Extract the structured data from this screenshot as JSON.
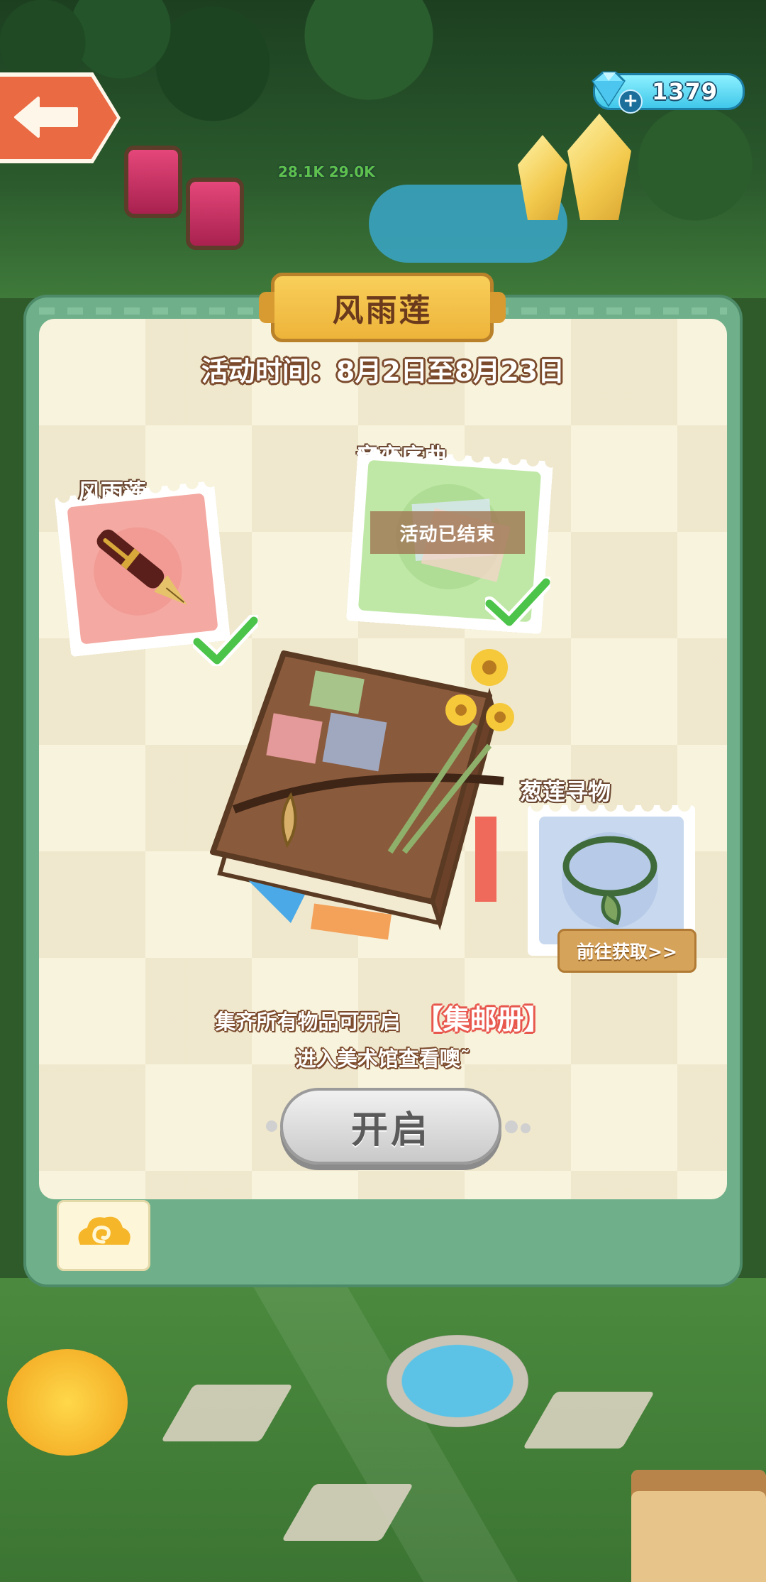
{
  "hud": {
    "gem_count": "1379",
    "floating_text": "28.1K 29.0K"
  },
  "panel": {
    "title": "风雨莲",
    "event_time": "活动时间：8月2日至8月23日"
  },
  "stamps": [
    {
      "label": "风雨莲",
      "collected": true,
      "item_icon": "fountain-pen-icon"
    },
    {
      "label": "音恋序曲",
      "collected": true,
      "status_text": "活动已结束",
      "item_icon": "postcards-icon"
    },
    {
      "label": "葱莲寻物",
      "collected": false,
      "item_icon": "necklace-icon",
      "action_label": "前往获取>>"
    }
  ],
  "footer": {
    "collect_text": "集齐所有物品可开启",
    "album_text": "【集邮册】",
    "enter_text": "进入美术馆查看噢˜",
    "open_button": "开启"
  },
  "colors": {
    "panel_green": "#6fb08a",
    "inner_cream": "#f8f3dc",
    "title_gold": "#f2c048",
    "album_red": "#e8574d",
    "check_green": "#4cc44a"
  }
}
